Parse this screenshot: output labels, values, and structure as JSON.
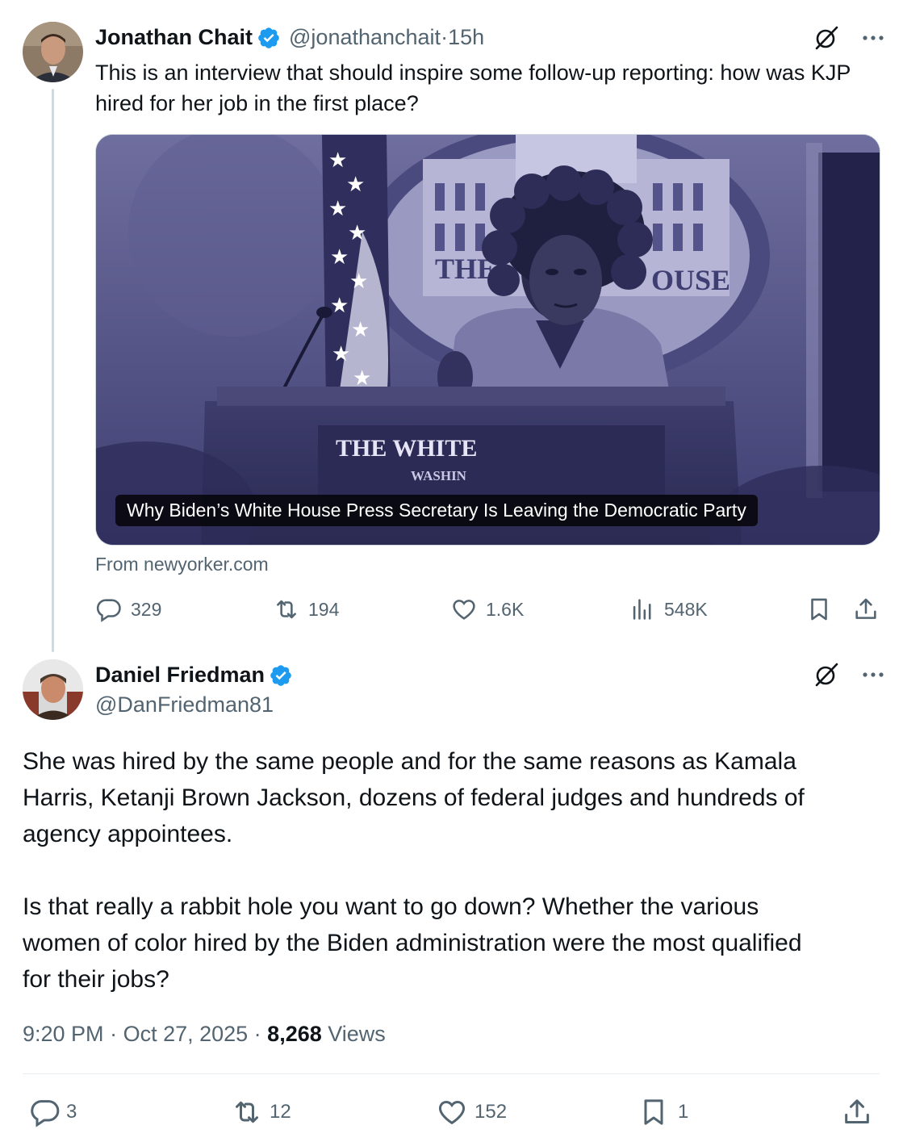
{
  "tweet1": {
    "display_name": "Jonathan Chait",
    "handle": "@jonathanchait",
    "sep": " · ",
    "time": "15h",
    "text_line1": "This is an interview that should inspire some follow-up reporting: how was KJP",
    "text_line2": "hired for her job in the first place?",
    "card": {
      "caption": "Why Biden’s White House Press Secretary Is Leaving the Democratic Party",
      "podium_text": "THE WHITE",
      "podium_sub": "WASHIN",
      "seal_left": "THE",
      "seal_right": "OUSE",
      "source": "From newyorker.com"
    },
    "actions": {
      "replies": "329",
      "reposts": "194",
      "likes": "1.6K",
      "views": "548K"
    }
  },
  "tweet2": {
    "display_name": "Daniel Friedman",
    "handle": "@DanFriedman81",
    "para1_line1": "She was hired by the same people and for the same reasons as Kamala",
    "para1_line2": "Harris, Ketanji Brown Jackson, dozens of federal judges and hundreds of",
    "para1_line3": "agency appointees.",
    "para2_line1": "Is that really a rabbit hole you want to go down? Whether the various",
    "para2_line2": "women of color hired by the Biden administration were the most qualified",
    "para2_line3": "for their jobs?",
    "time": "9:20 PM",
    "date": "Oct 27, 2025",
    "sep": " · ",
    "views_count": "8,268",
    "views_label": " Views",
    "actions": {
      "replies": "3",
      "reposts": "12",
      "likes": "152",
      "bookmarks": "1"
    }
  },
  "colors": {
    "verified": "#1d9bf0",
    "muted": "#536471",
    "text": "#0f1419",
    "card_tint": "#56558a"
  },
  "icons": [
    "grok-icon",
    "more-icon",
    "reply-icon",
    "repost-icon",
    "like-icon",
    "views-icon",
    "bookmark-icon",
    "share-icon",
    "verified-badge-icon"
  ]
}
